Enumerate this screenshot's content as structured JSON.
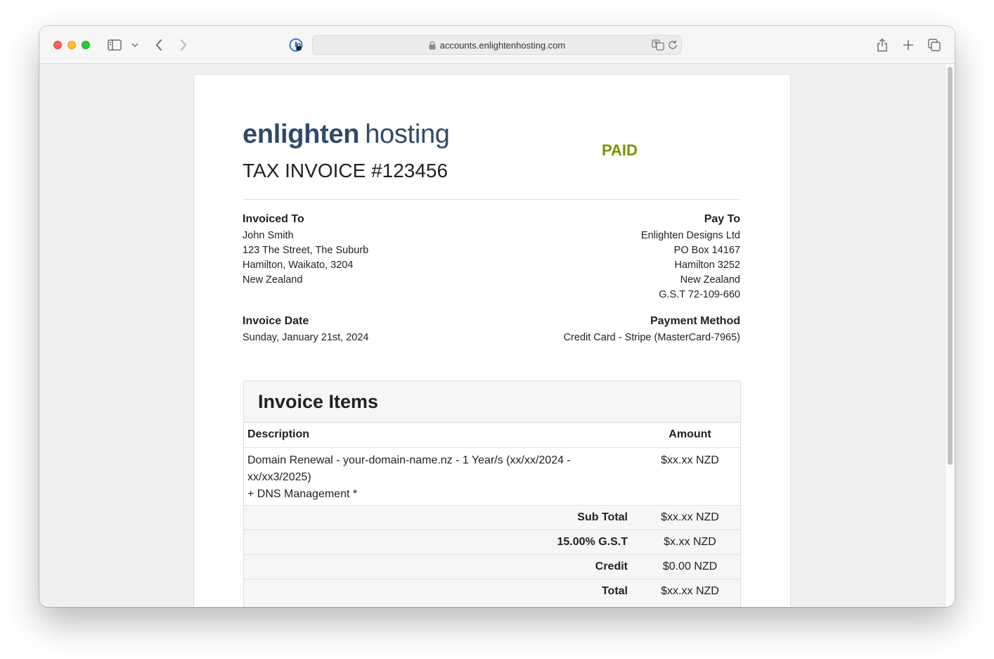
{
  "browser": {
    "url": "accounts.enlightenhosting.com"
  },
  "invoice": {
    "logo_bold": "enlighten",
    "logo_light": "hosting",
    "status": "PAID",
    "title": "TAX INVOICE #123456",
    "invoiced_to": {
      "heading": "Invoiced To",
      "lines": [
        "John Smith",
        "123 The Street, The Suburb",
        "Hamilton, Waikato, 3204",
        "New Zealand"
      ]
    },
    "pay_to": {
      "heading": "Pay To",
      "lines": [
        "Enlighten Designs Ltd",
        "PO Box 14167",
        "Hamilton 3252",
        "New Zealand",
        "G.S.T 72-109-660"
      ]
    },
    "invoice_date": {
      "heading": "Invoice Date",
      "value": "Sunday, January 21st, 2024"
    },
    "payment_method": {
      "heading": "Payment Method",
      "value": "Credit Card - Stripe (MasterCard-7965)"
    },
    "items": {
      "title": "Invoice Items",
      "col_description": "Description",
      "col_amount": "Amount",
      "rows": [
        {
          "desc_line1": "Domain Renewal - your-domain-name.nz - 1 Year/s (xx/xx/2024 -",
          "desc_line2": "xx/xx3/2025)",
          "desc_line3": "+ DNS Management *",
          "amount": "$xx.xx NZD"
        }
      ],
      "summary": [
        {
          "label": "Sub Total",
          "value": "$xx.xx NZD"
        },
        {
          "label": "15.00% G.S.T",
          "value": "$x.xx NZD"
        },
        {
          "label": "Credit",
          "value": "$0.00 NZD"
        },
        {
          "label": "Total",
          "value": "$xx.xx NZD"
        }
      ]
    }
  }
}
